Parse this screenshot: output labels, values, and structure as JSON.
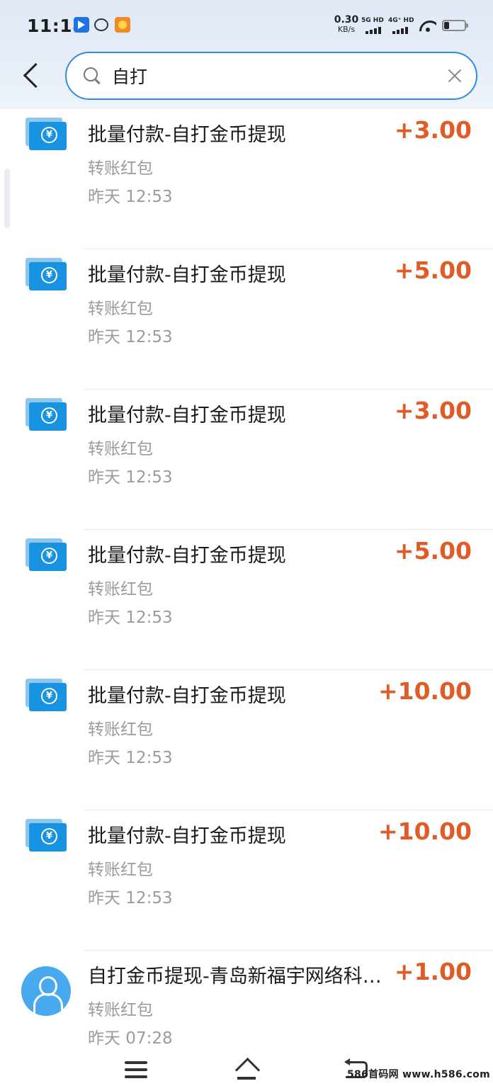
{
  "status_bar": {
    "time": "11:18",
    "net_speed_value": "0.30",
    "net_speed_unit": "KB/s",
    "sim1_label": "5G HD",
    "sim2_label": "4G⁺ HD",
    "battery_level": 0.25
  },
  "search": {
    "query": "自打"
  },
  "transactions": [
    {
      "title": "批量付款-自打金币提现",
      "subtitle": "转账红包",
      "time": "昨天 12:53",
      "amount": "+3.00",
      "icon": "transfer-icon"
    },
    {
      "title": "批量付款-自打金币提现",
      "subtitle": "转账红包",
      "time": "昨天 12:53",
      "amount": "+5.00",
      "icon": "transfer-icon"
    },
    {
      "title": "批量付款-自打金币提现",
      "subtitle": "转账红包",
      "time": "昨天 12:53",
      "amount": "+3.00",
      "icon": "transfer-icon"
    },
    {
      "title": "批量付款-自打金币提现",
      "subtitle": "转账红包",
      "time": "昨天 12:53",
      "amount": "+5.00",
      "icon": "transfer-icon"
    },
    {
      "title": "批量付款-自打金币提现",
      "subtitle": "转账红包",
      "time": "昨天 12:53",
      "amount": "+10.00",
      "icon": "transfer-icon"
    },
    {
      "title": "批量付款-自打金币提现",
      "subtitle": "转账红包",
      "time": "昨天 12:53",
      "amount": "+10.00",
      "icon": "transfer-icon"
    },
    {
      "title": "自打金币提现-青岛新福宇网络科…",
      "subtitle": "转账红包",
      "time": "昨天 07:28",
      "amount": "+1.00",
      "icon": "avatar-icon"
    }
  ],
  "transfer_icon_glyph": "¥",
  "watermark": "586首码网 www.h586.com",
  "colors": {
    "accent": "#2d8de6",
    "amount": "#e15b26",
    "icon_blue": "#1793e2",
    "avatar_blue": "#49a9ee"
  }
}
